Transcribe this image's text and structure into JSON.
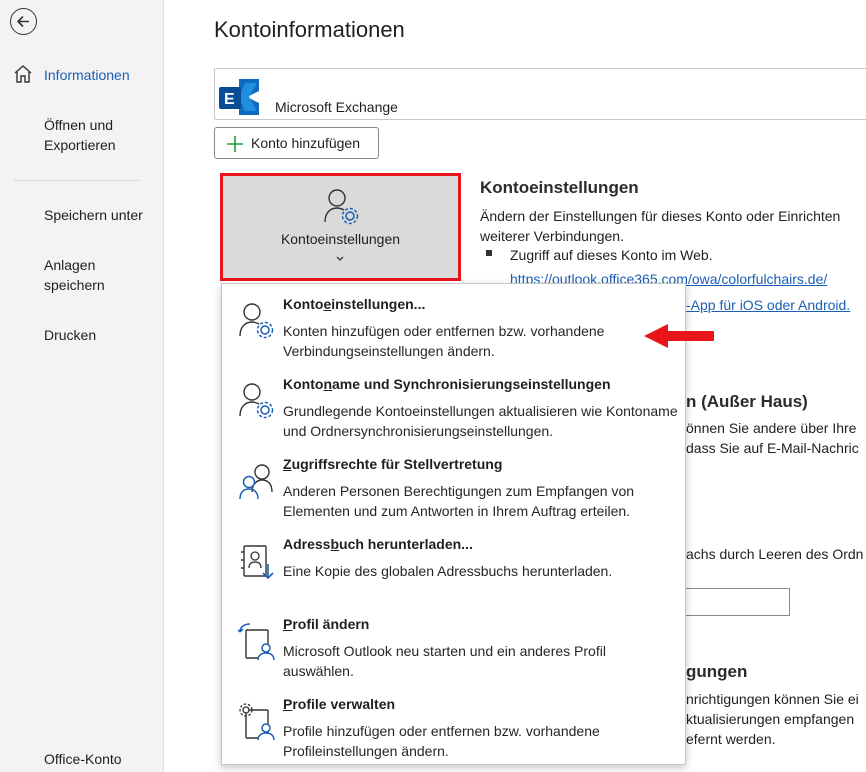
{
  "sidebar": {
    "items": [
      {
        "label": "Informationen"
      },
      {
        "label": "Öffnen und Exportieren"
      },
      {
        "label": "Speichern unter"
      },
      {
        "label": "Anlagen speichern"
      },
      {
        "label": "Drucken"
      },
      {
        "label": "Office-Konto"
      }
    ]
  },
  "main": {
    "title": "Kontoinformationen",
    "account_name": "Microsoft Exchange",
    "add_account_label": "Konto hinzufügen",
    "settings_tile_label": "Kontoeinstellungen",
    "section_heading": "Kontoeinstellungen",
    "section_desc": "Ändern der Einstellungen für dieses Konto oder Einrichten weiterer Verbindungen.",
    "bullet_text": "Zugriff auf dieses Konto im Web.",
    "web_link": "https://outlook.office365.com/owa/colorfulchairs.de/",
    "mobile_link": "-App für iOS oder Android.",
    "bg_texts": [
      "n (Außer Haus)",
      "önnen Sie andere über Ihre",
      "dass Sie auf E-Mail-Nachric",
      "achs durch Leeren des Ordn",
      "gungen",
      "nrichtigungen können Sie ei",
      "ktualisierungen empfangen",
      "efernt werden."
    ]
  },
  "dropdown": {
    "items": [
      {
        "title_pre": "Konto",
        "title_acc": "e",
        "title_post": "instellungen...",
        "desc": "Konten hinzufügen oder entfernen bzw. vorhandene Verbindungseinstellungen ändern."
      },
      {
        "title_pre": "Konto",
        "title_acc": "n",
        "title_post": "ame und Synchronisierungseinstellungen",
        "desc": "Grundlegende Kontoeinstellungen aktualisieren wie Kontoname und Ordnersynchronisierungseinstellungen."
      },
      {
        "title_pre": "",
        "title_acc": "Z",
        "title_post": "ugriffsrechte für Stellvertretung",
        "desc": "Anderen Personen Berechtigungen zum Empfangen von Elementen und zum Antworten in Ihrem Auftrag erteilen."
      },
      {
        "title_pre": "Adress",
        "title_acc": "b",
        "title_post": "uch herunterladen...",
        "desc": "Eine Kopie des globalen Adressbuchs herunterladen."
      },
      {
        "title_pre": "",
        "title_acc": "P",
        "title_post": "rofil ändern",
        "desc": "Microsoft Outlook neu starten und ein anderes Profil auswählen."
      },
      {
        "title_pre": "",
        "title_acc": "P",
        "title_post": "rofile verwalten",
        "desc": "Profile hinzufügen oder entfernen bzw. vorhandene Profileinstellungen ändern."
      }
    ]
  },
  "colors": {
    "accent": "#1b5fb5",
    "highlight_border": "#e8151b",
    "arrow": "#e8151b",
    "exchange": "#0f6cbd"
  }
}
